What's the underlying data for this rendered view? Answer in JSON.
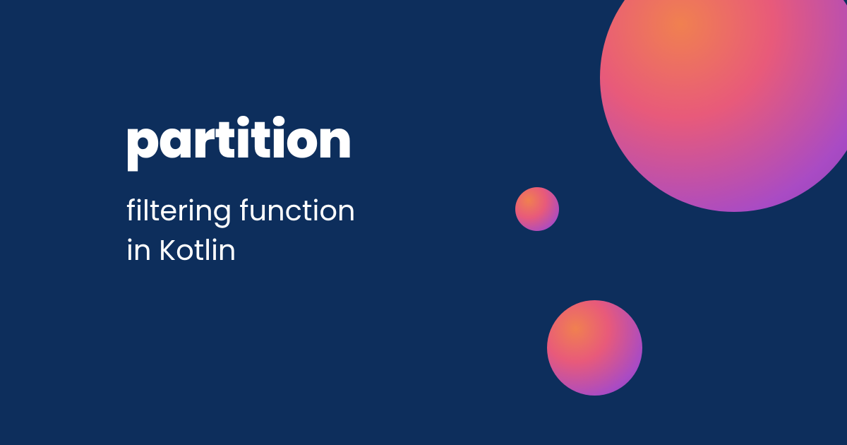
{
  "heading": {
    "title": "partition",
    "subtitle_line1": "filtering function",
    "subtitle_line2": "in Kotlin"
  },
  "colors": {
    "background": "#0d2e5c",
    "text": "#ffffff",
    "gradient_start": "#f08050",
    "gradient_mid": "#e85a7a",
    "gradient_end": "#8a3fb8"
  }
}
